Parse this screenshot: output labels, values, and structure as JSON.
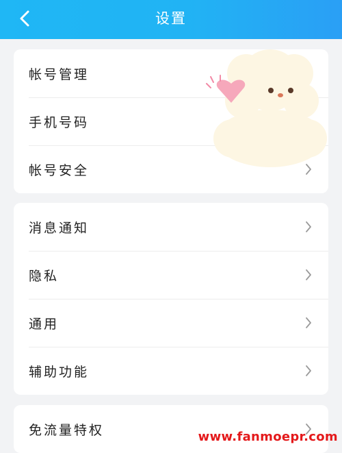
{
  "header": {
    "title": "设置",
    "back_icon": "chevron-left-icon"
  },
  "groups": [
    {
      "items": [
        {
          "label": "帐号管理",
          "chevron": false
        },
        {
          "label": "手机号码",
          "chevron": false
        },
        {
          "label": "帐号安全",
          "chevron": true
        }
      ]
    },
    {
      "items": [
        {
          "label": "消息通知",
          "chevron": true
        },
        {
          "label": "隐私",
          "chevron": true
        },
        {
          "label": "通用",
          "chevron": true
        },
        {
          "label": "辅助功能",
          "chevron": true
        }
      ]
    },
    {
      "items": [
        {
          "label": "免流量特权",
          "chevron": true
        }
      ]
    }
  ],
  "watermark": "www.fanmoepr.com",
  "colors": {
    "header": "#21b3f4",
    "background": "#f2f3f5",
    "watermark": "#e4191b"
  }
}
